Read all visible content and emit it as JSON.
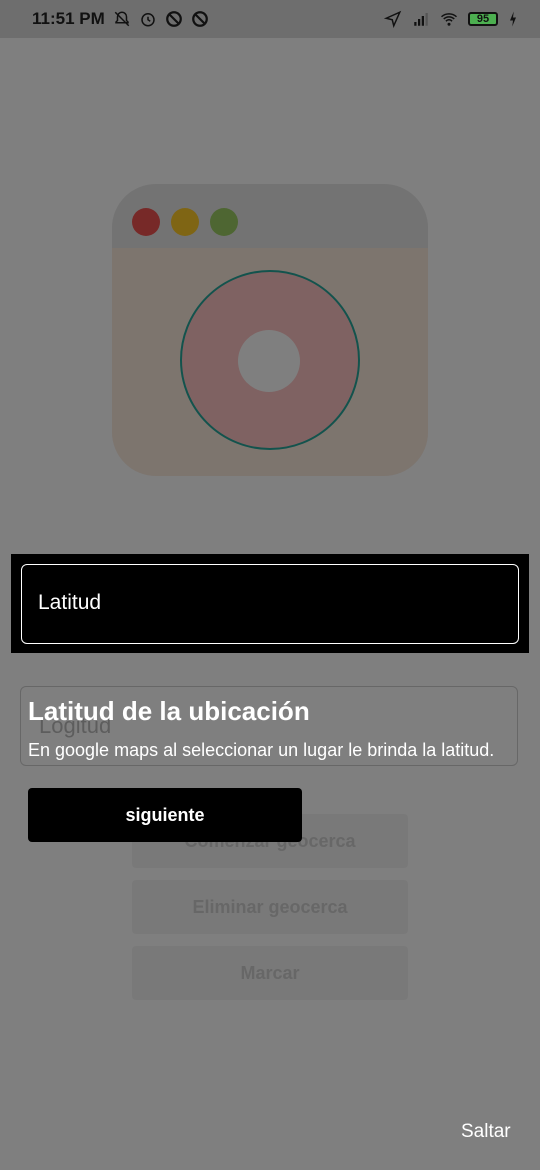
{
  "status_bar": {
    "time": "11:51 PM",
    "battery_level": "95",
    "icons": [
      "bell-off-icon",
      "alarm-icon",
      "dnd-icon",
      "dnd-icon-2",
      "location-icon",
      "signal-icon",
      "wifi-icon",
      "battery-icon",
      "charging-icon"
    ]
  },
  "form": {
    "latitude_label": "Latitud",
    "longitude_label": "Logitud"
  },
  "buttons": {
    "start": "Comenzar geocerca",
    "delete": "Eliminar geocerca",
    "mark": "Marcar"
  },
  "tutorial": {
    "title": "Latitud de la ubicación",
    "description": "En google maps al seleccionar un lugar le brinda la latitud.",
    "next_label": "siguiente",
    "skip_label": "Saltar"
  },
  "colors": {
    "overlay": "#000000",
    "dot_red": "#ef5350",
    "dot_yellow": "#ffca28",
    "dot_green": "#9ccc65",
    "ring": "#ffc4c4",
    "ring_border": "#26a69a"
  }
}
